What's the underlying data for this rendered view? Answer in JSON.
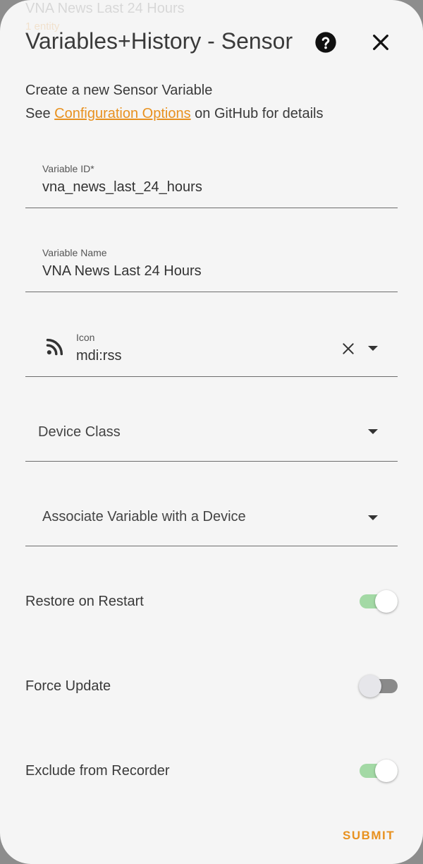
{
  "background_ghost": {
    "line1": "VNA News Last 24 Hours",
    "line2": "1 entity"
  },
  "dialog": {
    "title": "Variables+History - Sensor",
    "help_icon": "help-circle-icon",
    "close_icon": "close-icon",
    "intro_line1": "Create a new Sensor Variable",
    "intro_see": "See ",
    "intro_link": "Configuration Options",
    "intro_tail": " on GitHub for details"
  },
  "fields": {
    "variable_id": {
      "label": "Variable ID*",
      "value": "vna_news_last_24_hours"
    },
    "variable_name": {
      "label": "Variable Name",
      "value": "VNA News Last 24 Hours"
    },
    "icon": {
      "label": "Icon",
      "value": "mdi:rss",
      "icon": "rss-icon"
    },
    "device_class": {
      "placeholder": "Device Class"
    },
    "device": {
      "placeholder": "Associate Variable with a Device"
    }
  },
  "toggles": {
    "restore": {
      "label": "Restore on Restart",
      "on": true
    },
    "force_update": {
      "label": "Force Update",
      "on": false
    },
    "exclude_recorder": {
      "label": "Exclude from Recorder",
      "on": true
    }
  },
  "actions": {
    "submit": "SUBMIT"
  },
  "colors": {
    "accent": "#e8911f",
    "toggle_on_track": "#a3d9a5",
    "toggle_off_track": "#8a8a8a",
    "toggle_thumb_on": "#ffffff",
    "toggle_thumb_off": "#e6e6ea"
  }
}
